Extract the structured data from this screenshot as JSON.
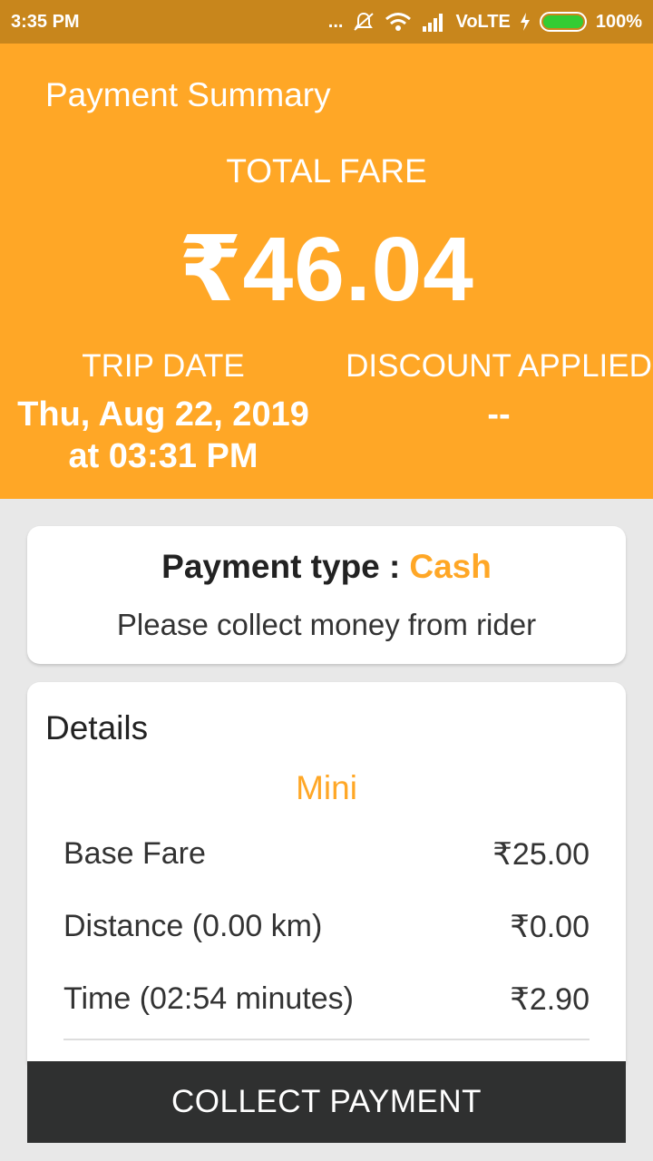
{
  "status_bar": {
    "time": "3:35 PM",
    "dots": "...",
    "network": "VoLTE",
    "battery": "100%"
  },
  "header": {
    "title": "Payment Summary",
    "total_fare_label": "TOTAL FARE",
    "total_fare_amount": "₹46.04",
    "trip_date_label": "TRIP DATE",
    "trip_date_line1": "Thu, Aug 22, 2019",
    "trip_date_line2": "at 03:31 PM",
    "discount_label": "DISCOUNT APPLIED",
    "discount_value": "--"
  },
  "payment_card": {
    "type_label": "Payment type :",
    "type_value": "Cash",
    "message": "Please collect money from rider"
  },
  "details_card": {
    "title": "Details",
    "vehicle": "Mini",
    "rows": [
      {
        "label": "Base Fare",
        "amount": "₹25.00"
      },
      {
        "label": "Distance (0.00 km)",
        "amount": "₹0.00"
      },
      {
        "label": "Time (02:54 minutes)",
        "amount": "₹2.90"
      }
    ]
  },
  "collect_button": {
    "label": "COLLECT PAYMENT"
  },
  "colors": {
    "accent": "#ffa726",
    "status_bar": "#c8861c",
    "button": "#2f3030"
  }
}
